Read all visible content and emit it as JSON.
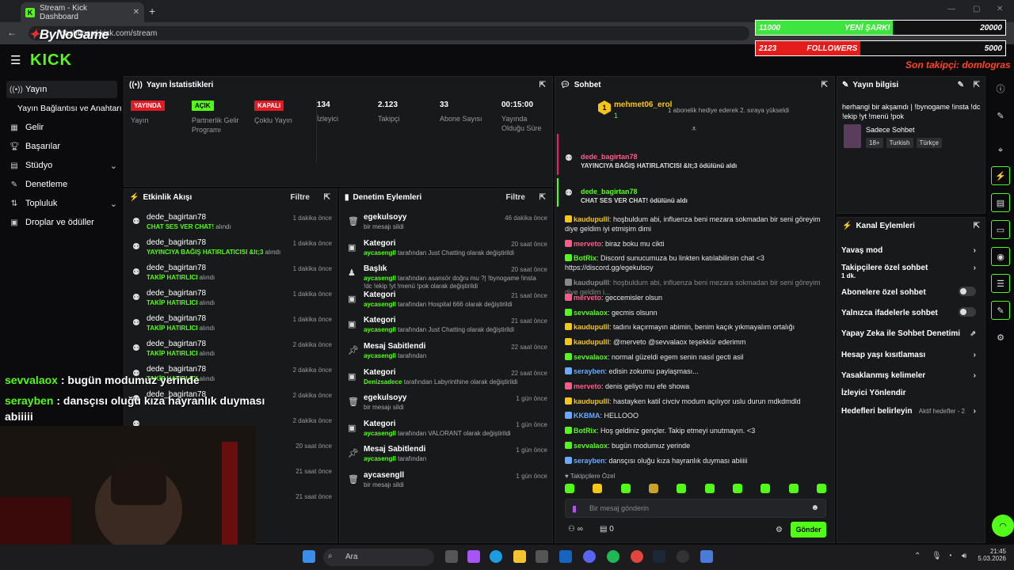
{
  "browser": {
    "tab_title": "Stream - Kick Dashboard",
    "url": "dashboard.kick.com/stream"
  },
  "overlay": {
    "brand": "ByNoGame",
    "bar1_left": "11000",
    "bar1_mid": "YENİ ŞARKI",
    "bar1_right": "20000",
    "bar1_progress": 0.55,
    "bar2_left": "2123",
    "bar2_mid": "FOLLOWERS",
    "bar2_right": "5000",
    "bar2_progress": 0.42,
    "last_follower": "Son takipçi: domlogras",
    "chat": [
      {
        "name": "sevvalaox",
        "text": " : bugün modumuz yerinde"
      },
      {
        "name": "serayben",
        "text": " : dansçısı oluğu kıza hayranlık duyması"
      },
      {
        "name": "",
        "text": "abiiiii"
      }
    ]
  },
  "nav": {
    "logo": "KICK"
  },
  "sidebar": {
    "items": [
      {
        "label": "Yayın",
        "icon": "broadcast-icon"
      },
      {
        "label": "Yayın Bağlantısı ve Anahtarı",
        "icon": ""
      },
      {
        "label": "Gelir",
        "icon": "grid-icon"
      },
      {
        "label": "Başarılar",
        "icon": "trophy-icon"
      },
      {
        "label": "Stüdyo",
        "icon": "studio-icon"
      },
      {
        "label": "Denetleme",
        "icon": "wrench-icon"
      },
      {
        "label": "Topluluk",
        "icon": "community-icon"
      },
      {
        "label": "Droplar ve ödüller",
        "icon": "drops-icon"
      }
    ]
  },
  "stats": {
    "title": "Yayın İstatistikleri",
    "items": [
      {
        "badge": "YAYINDA",
        "label": "Yayın",
        "color": "#e01b24"
      },
      {
        "badge": "AÇIK",
        "label": "Partnerlik Gelir Programı",
        "color": "#53fc18"
      },
      {
        "badge": "KAPALI",
        "label": "Çoklu Yayın",
        "color": "#e01b24"
      },
      {
        "value": "134",
        "label": "İzleyici"
      },
      {
        "value": "2.123",
        "label": "Takipçi"
      },
      {
        "value": "33",
        "label": "Abone Sayısı"
      },
      {
        "value": "00:15:00",
        "label": "Yayında Olduğu Süre"
      }
    ]
  },
  "activity": {
    "title": "Etkinlik Akışı",
    "filter": "Filtre",
    "events": [
      {
        "user": "dede_bagirtan78",
        "sub": "CHAT SES VER CHAT!",
        "suffix": " alındı",
        "time": "1 dakika önce"
      },
      {
        "user": "dede_bagirtan78",
        "sub": "YAYINCIYA BAĞIŞ HATIRLATICISI &lt;3",
        "suffix": " alındı",
        "time": "1 dakika önce"
      },
      {
        "user": "dede_bagirtan78",
        "sub": "TAKİP HATIRLICI",
        "suffix": " alındı",
        "time": "1 dakika önce"
      },
      {
        "user": "dede_bagirtan78",
        "sub": "TAKİP HATIRLICI",
        "suffix": " alındı",
        "time": "1 dakika önce"
      },
      {
        "user": "dede_bagirtan78",
        "sub": "TAKİP HATIRLICI",
        "suffix": " alındı",
        "time": "1 dakika önce"
      },
      {
        "user": "dede_bagirtan78",
        "sub": "TAKİP HATIRLICI",
        "suffix": " alındı",
        "time": "2 dakika önce"
      },
      {
        "user": "dede_bagirtan78",
        "sub": "TAKİP HATIRLICI",
        "suffix": " alındı",
        "time": "2 dakika önce"
      },
      {
        "user": "dede_bagirtan78",
        "sub": "",
        "suffix": "",
        "time": "2 dakika önce"
      },
      {
        "user": "",
        "sub": "",
        "suffix": "",
        "time": "2 dakika önce"
      },
      {
        "user": "",
        "sub": "",
        "suffix": "",
        "time": "20 saat önce"
      },
      {
        "user": "",
        "sub": "",
        "suffix": "",
        "time": "21 saat önce"
      },
      {
        "user": "",
        "sub": "",
        "suffix": "",
        "time": "21 saat önce"
      }
    ]
  },
  "modlog": {
    "title": "Denetim Eylemleri",
    "filter": "Filtre",
    "items": [
      {
        "title": "egekulsoyy",
        "pre": "bir mesajı sildi",
        "hl": "",
        "post": "",
        "time": "46 dakika önce",
        "icon": "trash-icon"
      },
      {
        "title": "Kategori",
        "pre": "",
        "hl": "aycasengll",
        "post": " tarafından Just Chatting olarak değiştirildi",
        "time": "20 saat önce",
        "icon": "category-icon"
      },
      {
        "title": "Başlık",
        "pre": "",
        "hl": "aycasengll",
        "post": " tarafından asansör doğru mu ?| !bynogame !insta !dc !ekip !yt !menü !pok olarak değiştirildi",
        "time": "20 saat önce",
        "icon": "title-icon"
      },
      {
        "title": "Kategori",
        "pre": "",
        "hl": "aycasengll",
        "post": " tarafından Hospital 666 olarak değiştirildi",
        "time": "21 saat önce",
        "icon": "category-icon"
      },
      {
        "title": "Kategori",
        "pre": "",
        "hl": "aycasengll",
        "post": " tarafından Just Chatting olarak değiştirildi",
        "time": "21 saat önce",
        "icon": "category-icon"
      },
      {
        "title": "Mesaj Sabitlendi",
        "pre": "",
        "hl": "aycasengll",
        "post": " tarafından",
        "time": "22 saat önce",
        "icon": "pin-icon"
      },
      {
        "title": "Kategori",
        "pre": "",
        "hl": "Denizsadece",
        "post": " tarafından Labyrinthine olarak değiştirildi",
        "time": "22 saat önce",
        "icon": "category-icon"
      },
      {
        "title": "egekulsoyy",
        "pre": "bir mesajı sildi",
        "hl": "",
        "post": "",
        "time": "1 gün önce",
        "icon": "trash-icon"
      },
      {
        "title": "Kategori",
        "pre": "",
        "hl": "aycasengll",
        "post": " tarafından VALORANT olarak değiştirildi",
        "time": "1 gün önce",
        "icon": "category-icon"
      },
      {
        "title": "Mesaj Sabitlendi",
        "pre": "",
        "hl": "aycasengll",
        "post": " tarafından",
        "time": "1 gün önce",
        "icon": "pin-icon"
      },
      {
        "title": "aycasengll",
        "pre": "bir mesajı sildi",
        "hl": "",
        "post": "",
        "time": "1 gün önce",
        "icon": "trash-icon"
      }
    ]
  },
  "chat": {
    "title": "Sohbet",
    "top_user": "mehmet06_erol",
    "top_count": "1",
    "top_note": "1 abonelik hediye ederek 2. sıraya yükseldi",
    "reward1_user": "dede_bagirtan78",
    "reward1_text": "YAYINCIYA BAĞIŞ HATIRLATICISI &lt;3 ödülünü aldı",
    "reward2_user": "dede_bagirtan78",
    "reward2_text": "CHAT SES VER CHAT! ödülünü aldı",
    "messages": [
      {
        "name": "kaudupulll",
        "color": "#f5c518",
        "text": ": hoşbuldum abi, influenza beni mezara sokmadan bir seni göreyim diye geldim iyi etmişim dimi",
        "lines": 2
      },
      {
        "name": "merveto",
        "color": "#ff5b8a",
        "text": ": biraz boku mu cikti",
        "lines": 1
      },
      {
        "name": "BotRix",
        "color": "#53fc18",
        "text": ": Discord sunucumuza bu linkten katılabilirsin chat <3 https://discord.gg/egekulsoy",
        "lines": 2
      },
      {
        "name": "kaudupulll",
        "color": "#888",
        "text": ": hoşbuldum abi, influenza beni mezara sokmadan bir seni göreyim diye geldim i...",
        "lines": 1
      },
      {
        "name": "merveto",
        "color": "#ff5b8a",
        "text": ": geccemisler olsun",
        "lines": 1
      },
      {
        "name": "sevvalaox",
        "color": "#53fc18",
        "text": ": gecmis olsunn",
        "lines": 1
      },
      {
        "name": "kaudupulll",
        "color": "#f5c518",
        "text": ": tadını kaçırmayın abimin, benim kaçık yıkmayalım ortalığı",
        "lines": 1
      },
      {
        "name": "kaudupulll",
        "color": "#f5c518",
        "text": ": @merveto @sevvalaox teşekkür ederimm",
        "lines": 1
      },
      {
        "name": "sevvalaox",
        "color": "#53fc18",
        "text": ": normal güzeldi egem senin nasıl gecti asil",
        "lines": 1
      },
      {
        "name": "serayben",
        "color": "#6aa9ff",
        "text": ": edisin zokumu paylaşması...",
        "lines": 1
      },
      {
        "name": "merveto",
        "color": "#ff5b8a",
        "text": ": denis geliyo mu efe showa",
        "lines": 1
      },
      {
        "name": "kaudupulll",
        "color": "#f5c518",
        "text": ": hastayken katil civciv modum açılıyor uslu durun mdkdmdld",
        "lines": 1
      },
      {
        "name": "KKBMA",
        "color": "#6aa9ff",
        "text": ": HELLOOO",
        "lines": 1
      },
      {
        "name": "BotRix",
        "color": "#53fc18",
        "text": ": Hoş geldiniz gençler. Takip etmeyi unutmayın. <3",
        "lines": 1
      },
      {
        "name": "sevvalaox",
        "color": "#53fc18",
        "text": ": bugün modumuz yerinde",
        "lines": 1
      },
      {
        "name": "serayben",
        "color": "#6aa9ff",
        "text": ": dansçısı oluğu kıza hayranlık duyması abiiiii",
        "lines": 1
      }
    ],
    "emote_label": "Takipçilere Özel",
    "input_placeholder": "Bir mesaj gönderin",
    "viewers_label": "∞",
    "count": "0",
    "send": "Gönder"
  },
  "info": {
    "title": "Yayın bilgisi",
    "stream_title": "herhangi bir akşamdı | !bynogame !insta !dc !ekip !yt !menü !pok",
    "category": "Sadece Sohbet",
    "tags": [
      "18+",
      "Turkish",
      "Türkçe"
    ]
  },
  "channel": {
    "title": "Kanal Eylemleri",
    "rows": [
      {
        "label": "Yavaş mod",
        "sub": "",
        "kind": "chev"
      },
      {
        "label": "Takipçilere özel sohbet",
        "sub": "1 dk.",
        "kind": "chev"
      },
      {
        "label": "Abonelere özel sohbet",
        "sub": "",
        "kind": "toggle"
      },
      {
        "label": "Yalnızca ifadelerle sohbet",
        "sub": "",
        "kind": "toggle"
      },
      {
        "label": "Yapay Zeka ile Sohbet Denetimi",
        "sub": "",
        "kind": "ext"
      },
      {
        "label": "Hesap yaşı kısıtlaması",
        "sub": "",
        "kind": "chev"
      },
      {
        "label": "Yasaklanmış kelimeler",
        "sub": "",
        "kind": "chev"
      },
      {
        "label": "İzleyici Yönlendir",
        "sub": "",
        "kind": "none"
      },
      {
        "label": "Hedefleri belirleyin",
        "sub": "Aktif hedefler - 2",
        "kind": "chev"
      }
    ]
  },
  "taskbar": {
    "search": "Ara",
    "time": "21:45",
    "date": "5.03.2026"
  }
}
